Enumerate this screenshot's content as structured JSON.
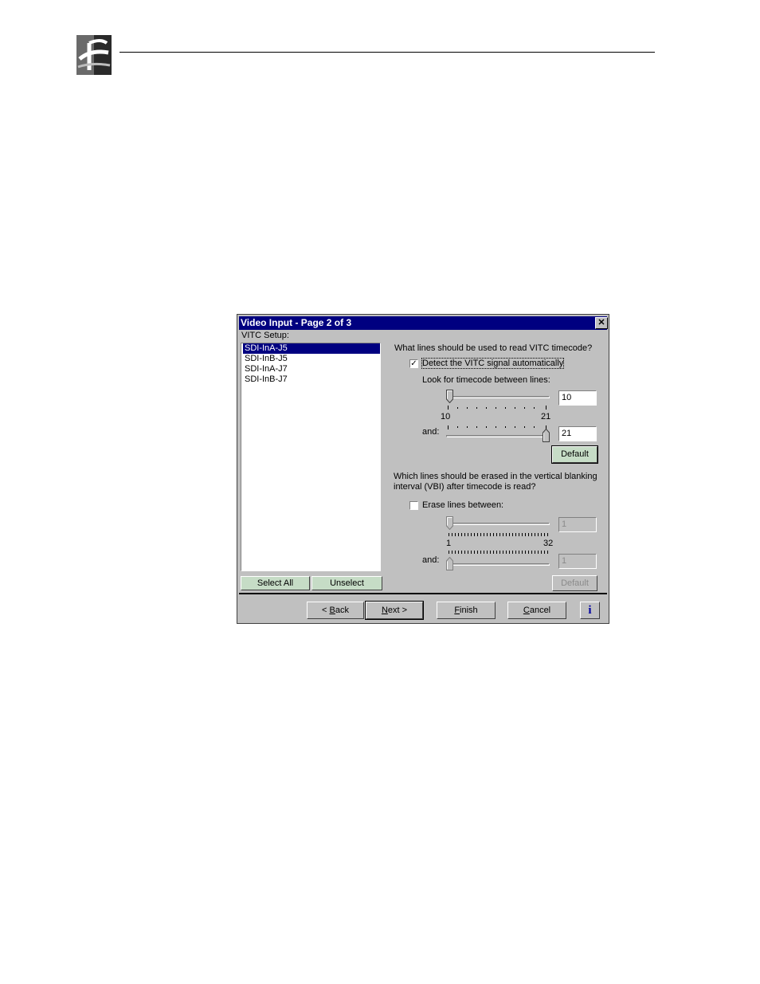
{
  "dialog": {
    "title": "Video Input - Page 2 of 3",
    "close_label": "✕",
    "vitc_setup_label": "VITC Setup:",
    "list_items": [
      {
        "label": "SDI-InA-J5",
        "selected": true
      },
      {
        "label": "SDI-InB-J5",
        "selected": false
      },
      {
        "label": "SDI-InA-J7",
        "selected": false
      },
      {
        "label": "SDI-InB-J7",
        "selected": false
      }
    ],
    "select_all_label": "Select All",
    "unselect_label": "Unselect",
    "read": {
      "question": "What lines should be used to read VITC timecode?",
      "detect_label": "Detect the VITC signal automatically",
      "detect_checked": true,
      "look_label": "Look for timecode between lines:",
      "start_value": "10",
      "end_value": "21",
      "range_min": "10",
      "range_max": "21",
      "and_label": "and:",
      "default_label": "Default"
    },
    "erase": {
      "question_line1": "Which lines should be erased in the vertical blanking",
      "question_line2": "interval (VBI) after timecode is read?",
      "erase_label": "Erase lines between:",
      "erase_checked": false,
      "start_value": "1",
      "end_value": "1",
      "range_min": "1",
      "range_max": "32",
      "and_label": "and:",
      "default_label": "Default"
    },
    "footer": {
      "back_label": "Back",
      "back_prefix": "< ",
      "next_label": "ext >",
      "next_accel": "N",
      "finish_label": "inish",
      "finish_accel": "F",
      "cancel_label": "ancel",
      "cancel_accel": "C",
      "back_accel": "B",
      "back_rest": "ack",
      "info_label": "i"
    }
  }
}
